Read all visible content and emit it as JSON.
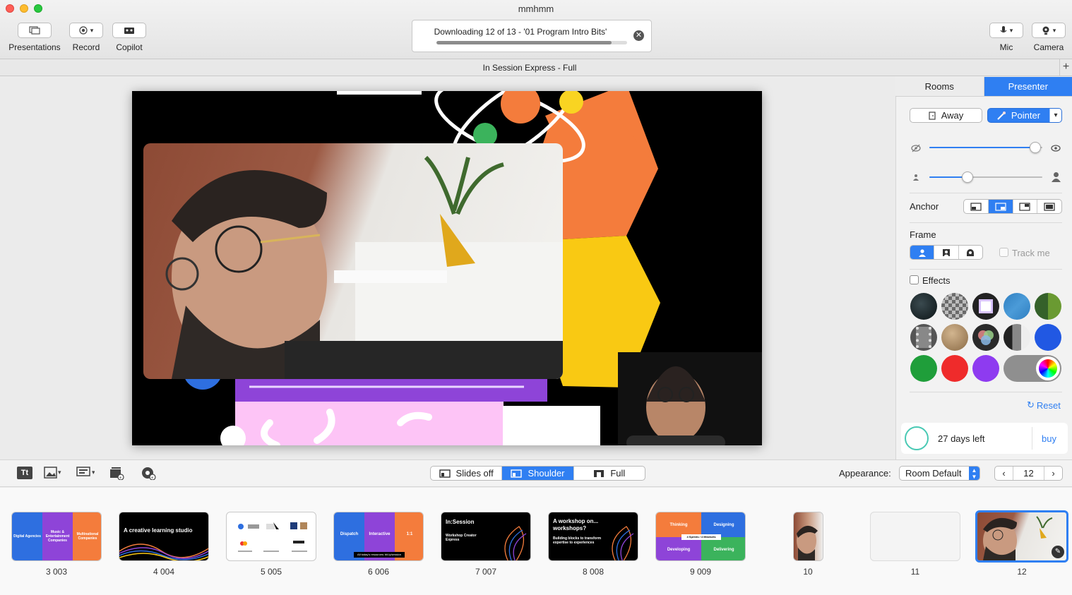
{
  "window": {
    "title": "mmhmm"
  },
  "toolbar": {
    "presentations_label": "Presentations",
    "record_label": "Record",
    "copilot_label": "Copilot",
    "mic_label": "Mic",
    "camera_label": "Camera"
  },
  "download": {
    "text": "Downloading 12 of 13 - '01 Program Intro Bits'",
    "progress": 0.92
  },
  "tab": {
    "title": "In Session Express - Full"
  },
  "sidebar": {
    "tabs": [
      "Rooms",
      "Presenter"
    ],
    "active_tab": "Presenter",
    "away_label": "Away",
    "pointer_label": "Pointer",
    "opacity_level": 0.94,
    "size_level": 0.34,
    "anchor_label": "Anchor",
    "frame_label": "Frame",
    "track_me_label": "Track me",
    "effects_label": "Effects",
    "reset_label": "Reset",
    "trial": {
      "days_left": "27 days left",
      "buy_label": "buy"
    }
  },
  "bottom": {
    "layout_options": [
      "Slides off",
      "Shoulder",
      "Full"
    ],
    "layout_selected": "Shoulder",
    "appearance_label": "Appearance:",
    "appearance_value": "Room Default",
    "page_number": "12"
  },
  "slides": [
    {
      "label": "3 003"
    },
    {
      "label": "4 004",
      "title": "A creative learning studio"
    },
    {
      "label": "5 005"
    },
    {
      "label": "6 006",
      "cols": [
        "Dispatch",
        "Interactive",
        "1:1"
      ],
      "footer": "All today's resources: bit.ly/session"
    },
    {
      "label": "7 007",
      "title": "In:Session",
      "sub": "Workshop Creator Express"
    },
    {
      "label": "8 008",
      "title": "A workshop on... workshops?",
      "sub": "Building blocks to transform expertise to experiences"
    },
    {
      "label": "9 009",
      "cells": [
        "Thinking",
        "Designing",
        "Developing",
        "Delivering"
      ],
      "center": "4 Sprints / 4 Mindsets"
    },
    {
      "label": "10"
    },
    {
      "label": "11"
    },
    {
      "label": "12"
    }
  ],
  "slide3_cols": [
    "Digital Agencies",
    "Music & Entertainment Companies",
    "Multinational Companies"
  ],
  "colors": {
    "accent": "#2f7ff2",
    "orange": "#f47c3c",
    "purple": "#8e44d8",
    "blue": "#2e6fe0",
    "green": "#3bb35c"
  }
}
